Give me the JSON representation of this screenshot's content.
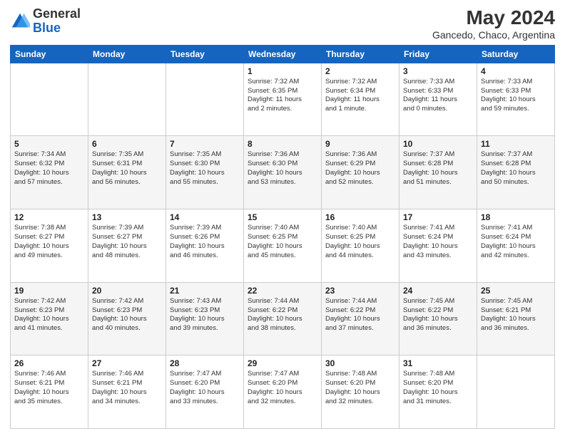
{
  "header": {
    "logo_general": "General",
    "logo_blue": "Blue",
    "month_year": "May 2024",
    "location": "Gancedo, Chaco, Argentina"
  },
  "weekdays": [
    "Sunday",
    "Monday",
    "Tuesday",
    "Wednesday",
    "Thursday",
    "Friday",
    "Saturday"
  ],
  "weeks": [
    [
      {
        "day": "",
        "info": ""
      },
      {
        "day": "",
        "info": ""
      },
      {
        "day": "",
        "info": ""
      },
      {
        "day": "1",
        "info": "Sunrise: 7:32 AM\nSunset: 6:35 PM\nDaylight: 11 hours\nand 2 minutes."
      },
      {
        "day": "2",
        "info": "Sunrise: 7:32 AM\nSunset: 6:34 PM\nDaylight: 11 hours\nand 1 minute."
      },
      {
        "day": "3",
        "info": "Sunrise: 7:33 AM\nSunset: 6:33 PM\nDaylight: 11 hours\nand 0 minutes."
      },
      {
        "day": "4",
        "info": "Sunrise: 7:33 AM\nSunset: 6:33 PM\nDaylight: 10 hours\nand 59 minutes."
      }
    ],
    [
      {
        "day": "5",
        "info": "Sunrise: 7:34 AM\nSunset: 6:32 PM\nDaylight: 10 hours\nand 57 minutes."
      },
      {
        "day": "6",
        "info": "Sunrise: 7:35 AM\nSunset: 6:31 PM\nDaylight: 10 hours\nand 56 minutes."
      },
      {
        "day": "7",
        "info": "Sunrise: 7:35 AM\nSunset: 6:30 PM\nDaylight: 10 hours\nand 55 minutes."
      },
      {
        "day": "8",
        "info": "Sunrise: 7:36 AM\nSunset: 6:30 PM\nDaylight: 10 hours\nand 53 minutes."
      },
      {
        "day": "9",
        "info": "Sunrise: 7:36 AM\nSunset: 6:29 PM\nDaylight: 10 hours\nand 52 minutes."
      },
      {
        "day": "10",
        "info": "Sunrise: 7:37 AM\nSunset: 6:28 PM\nDaylight: 10 hours\nand 51 minutes."
      },
      {
        "day": "11",
        "info": "Sunrise: 7:37 AM\nSunset: 6:28 PM\nDaylight: 10 hours\nand 50 minutes."
      }
    ],
    [
      {
        "day": "12",
        "info": "Sunrise: 7:38 AM\nSunset: 6:27 PM\nDaylight: 10 hours\nand 49 minutes."
      },
      {
        "day": "13",
        "info": "Sunrise: 7:39 AM\nSunset: 6:27 PM\nDaylight: 10 hours\nand 48 minutes."
      },
      {
        "day": "14",
        "info": "Sunrise: 7:39 AM\nSunset: 6:26 PM\nDaylight: 10 hours\nand 46 minutes."
      },
      {
        "day": "15",
        "info": "Sunrise: 7:40 AM\nSunset: 6:25 PM\nDaylight: 10 hours\nand 45 minutes."
      },
      {
        "day": "16",
        "info": "Sunrise: 7:40 AM\nSunset: 6:25 PM\nDaylight: 10 hours\nand 44 minutes."
      },
      {
        "day": "17",
        "info": "Sunrise: 7:41 AM\nSunset: 6:24 PM\nDaylight: 10 hours\nand 43 minutes."
      },
      {
        "day": "18",
        "info": "Sunrise: 7:41 AM\nSunset: 6:24 PM\nDaylight: 10 hours\nand 42 minutes."
      }
    ],
    [
      {
        "day": "19",
        "info": "Sunrise: 7:42 AM\nSunset: 6:23 PM\nDaylight: 10 hours\nand 41 minutes."
      },
      {
        "day": "20",
        "info": "Sunrise: 7:42 AM\nSunset: 6:23 PM\nDaylight: 10 hours\nand 40 minutes."
      },
      {
        "day": "21",
        "info": "Sunrise: 7:43 AM\nSunset: 6:23 PM\nDaylight: 10 hours\nand 39 minutes."
      },
      {
        "day": "22",
        "info": "Sunrise: 7:44 AM\nSunset: 6:22 PM\nDaylight: 10 hours\nand 38 minutes."
      },
      {
        "day": "23",
        "info": "Sunrise: 7:44 AM\nSunset: 6:22 PM\nDaylight: 10 hours\nand 37 minutes."
      },
      {
        "day": "24",
        "info": "Sunrise: 7:45 AM\nSunset: 6:22 PM\nDaylight: 10 hours\nand 36 minutes."
      },
      {
        "day": "25",
        "info": "Sunrise: 7:45 AM\nSunset: 6:21 PM\nDaylight: 10 hours\nand 36 minutes."
      }
    ],
    [
      {
        "day": "26",
        "info": "Sunrise: 7:46 AM\nSunset: 6:21 PM\nDaylight: 10 hours\nand 35 minutes."
      },
      {
        "day": "27",
        "info": "Sunrise: 7:46 AM\nSunset: 6:21 PM\nDaylight: 10 hours\nand 34 minutes."
      },
      {
        "day": "28",
        "info": "Sunrise: 7:47 AM\nSunset: 6:20 PM\nDaylight: 10 hours\nand 33 minutes."
      },
      {
        "day": "29",
        "info": "Sunrise: 7:47 AM\nSunset: 6:20 PM\nDaylight: 10 hours\nand 32 minutes."
      },
      {
        "day": "30",
        "info": "Sunrise: 7:48 AM\nSunset: 6:20 PM\nDaylight: 10 hours\nand 32 minutes."
      },
      {
        "day": "31",
        "info": "Sunrise: 7:48 AM\nSunset: 6:20 PM\nDaylight: 10 hours\nand 31 minutes."
      },
      {
        "day": "",
        "info": ""
      }
    ]
  ]
}
